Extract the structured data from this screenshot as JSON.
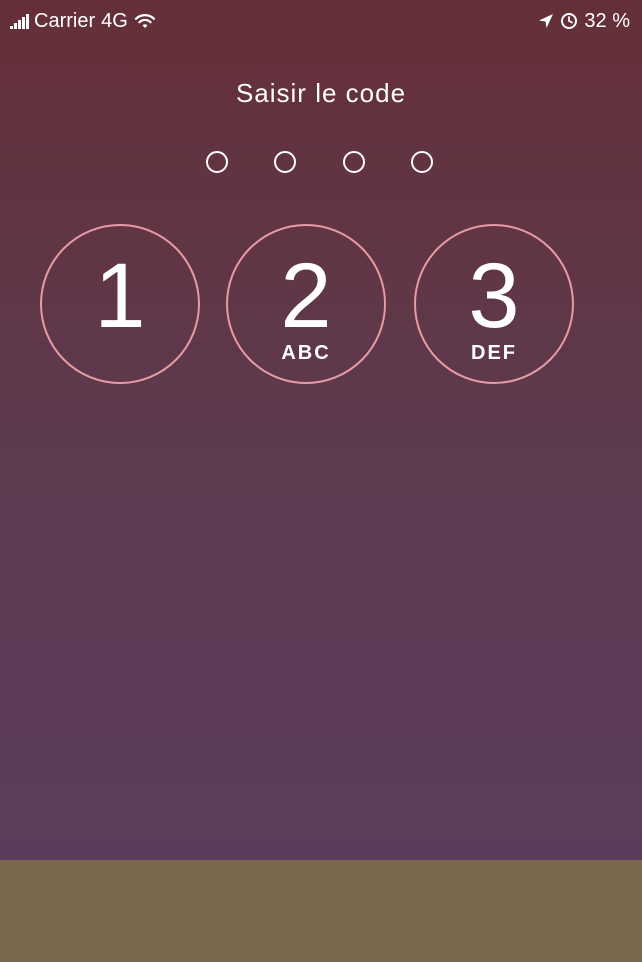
{
  "status_bar": {
    "carrier": "Carrier",
    "network": "4G",
    "battery": "32 %",
    "icons": [
      "signal-icon",
      "wifi-icon",
      "location-arrow-icon",
      "alarm-clock-icon"
    ]
  },
  "passcode": {
    "title": "Saisir le code",
    "digits_entered": 0,
    "total_digits": 4
  },
  "keypad": {
    "keys": [
      {
        "digit": "1",
        "letters": ""
      },
      {
        "digit": "2",
        "letters": "ABC"
      },
      {
        "digit": "3",
        "letters": "DEF"
      }
    ]
  },
  "colors": {
    "gradient_top": "#652f38",
    "gradient_bottom": "#5b3d5e",
    "key_border": "#e89aa5",
    "bottom_bar": "#7a694e",
    "text": "#ffffff"
  }
}
